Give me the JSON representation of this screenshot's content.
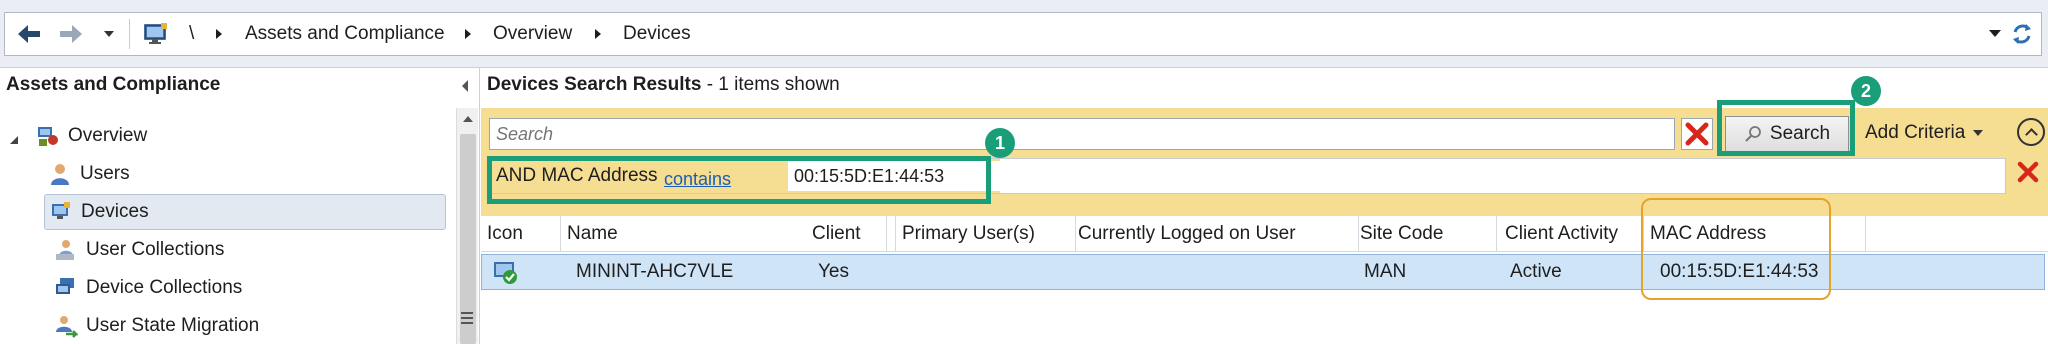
{
  "address_bar": {
    "root": "\\",
    "breadcrumbs": [
      "Assets and Compliance",
      "Overview",
      "Devices"
    ],
    "icons": [
      "back-arrow-icon",
      "forward-arrow-icon",
      "dropdown-icon",
      "monitor-icon",
      "refresh-icon"
    ]
  },
  "nav": {
    "title": "Assets and Compliance",
    "items": [
      {
        "label": "Overview",
        "icon": "overview-icon"
      },
      {
        "label": "Users",
        "icon": "user-icon"
      },
      {
        "label": "Devices",
        "icon": "devices-icon",
        "selected": true
      },
      {
        "label": "User Collections",
        "icon": "user-collections-icon"
      },
      {
        "label": "Device Collections",
        "icon": "device-collections-icon"
      },
      {
        "label": "User State Migration",
        "icon": "user-state-migration-icon"
      }
    ]
  },
  "results": {
    "title": "Devices Search Results",
    "count_text": "-  1 items shown"
  },
  "search": {
    "placeholder": "Search",
    "button_label": "Search",
    "add_criteria_label": "Add Criteria",
    "criteria": {
      "label": "AND MAC Address",
      "operator": "contains",
      "value": "00:15:5D:E1:44:53"
    }
  },
  "annotations": {
    "criteria_badge": "1",
    "search_badge": "2"
  },
  "table": {
    "columns": [
      "Icon",
      "Name",
      "Client",
      "Primary User(s)",
      "Currently Logged on User",
      "Site Code",
      "Client Activity",
      "MAC Address"
    ],
    "rows": [
      {
        "name": "MININT-AHC7VLE",
        "client": "Yes",
        "primary_users": "",
        "logged_on_user": "",
        "site_code": "MAN",
        "client_activity": "Active",
        "mac_address": "00:15:5D:E1:44:53"
      }
    ]
  },
  "colors": {
    "accent_green": "#1a9e7a",
    "search_band": "#f5dd92",
    "highlight_orange": "#e3a32c",
    "selection": "#cfe4f7"
  }
}
